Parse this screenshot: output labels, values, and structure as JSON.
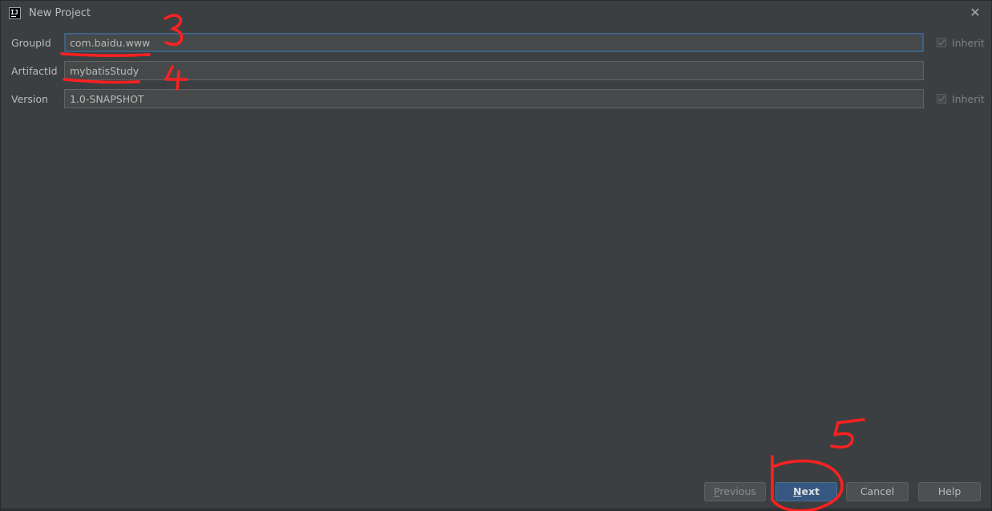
{
  "window": {
    "title": "New Project",
    "icon": "intellij-icon",
    "close_icon": "close-icon"
  },
  "form": {
    "group_id": {
      "label": "GroupId",
      "value": "com.baidu.www",
      "inherit_label": "Inherit",
      "inherit_checked": true
    },
    "artifact_id": {
      "label": "ArtifactId",
      "value": "mybatisStudy"
    },
    "version": {
      "label": "Version",
      "value": "1.0-SNAPSHOT",
      "inherit_label": "Inherit",
      "inherit_checked": true
    }
  },
  "buttons": {
    "previous": {
      "mnemonic": "P",
      "rest": "revious"
    },
    "next": {
      "mnemonic": "N",
      "rest": "ext"
    },
    "cancel": "Cancel",
    "help": "Help"
  },
  "annotations": {
    "color": "#ff2020",
    "marks": [
      "3",
      "4",
      "5"
    ]
  },
  "colors": {
    "background": "#3c3f41",
    "field_bg": "#45494a",
    "focus_border": "#3d6185",
    "default_button": "#365880"
  }
}
